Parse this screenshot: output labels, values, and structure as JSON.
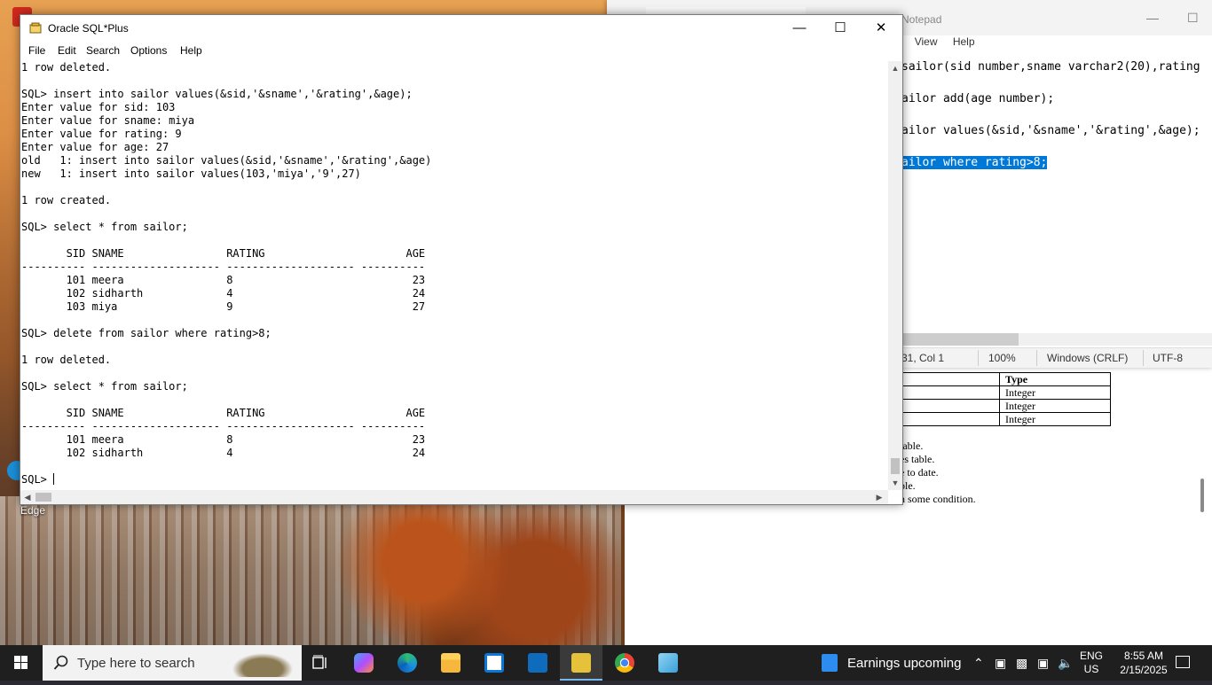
{
  "desktop": {
    "icon_labels": [
      "Edge"
    ]
  },
  "document": {
    "table_header": "Type",
    "table_rows": [
      "Integer",
      "Integer",
      "Integer"
    ],
    "lines": [
      "table.",
      "es table.",
      "e to date.",
      "ble.",
      "h some condition."
    ]
  },
  "notepad": {
    "title": "Notepad",
    "menu": [
      "t",
      "View",
      "Help"
    ],
    "lines": [
      "sailor(sid number,sname varchar2(20),rating",
      "ailor add(age number);",
      "ailor values(&sid,'&sname','&rating',&age);",
      "ailor where rating>8;"
    ],
    "status": {
      "position": "31, Col 1",
      "zoom": "100%",
      "line_ending": "Windows (CRLF)",
      "encoding": "UTF-8"
    }
  },
  "sqlplus": {
    "title": "Oracle SQL*Plus",
    "menu": [
      "File",
      "Edit",
      "Search",
      "Options",
      "Help"
    ],
    "console_lines": [
      "1 row deleted.",
      "",
      "SQL> insert into sailor values(&sid,'&sname','&rating',&age);",
      "Enter value for sid: 103",
      "Enter value for sname: miya",
      "Enter value for rating: 9",
      "Enter value for age: 27",
      "old   1: insert into sailor values(&sid,'&sname','&rating',&age)",
      "new   1: insert into sailor values(103,'miya','9',27)",
      "",
      "1 row created.",
      "",
      "SQL> select * from sailor;",
      "",
      "       SID SNAME                RATING                      AGE",
      "---------- -------------------- -------------------- ----------",
      "       101 meera                8                            23",
      "       102 sidharth             4                            24",
      "       103 miya                 9                            27",
      "",
      "SQL> delete from sailor where rating>8;",
      "",
      "1 row deleted.",
      "",
      "SQL> select * from sailor;",
      "",
      "       SID SNAME                RATING                      AGE",
      "---------- -------------------- -------------------- ----------",
      "       101 meera                8                            23",
      "       102 sidharth             4                            24",
      ""
    ],
    "prompt": "SQL> "
  },
  "taskbar": {
    "search_placeholder": "Type here to search",
    "news": "Earnings upcoming",
    "lang_1": "ENG",
    "lang_2": "US",
    "time": "8:55 AM",
    "date": "2/15/2025",
    "apps": [
      "task-view",
      "copilot",
      "edge",
      "file-explorer",
      "microsoft-store",
      "outlook",
      "sqlplus",
      "chrome",
      "notepad"
    ]
  }
}
